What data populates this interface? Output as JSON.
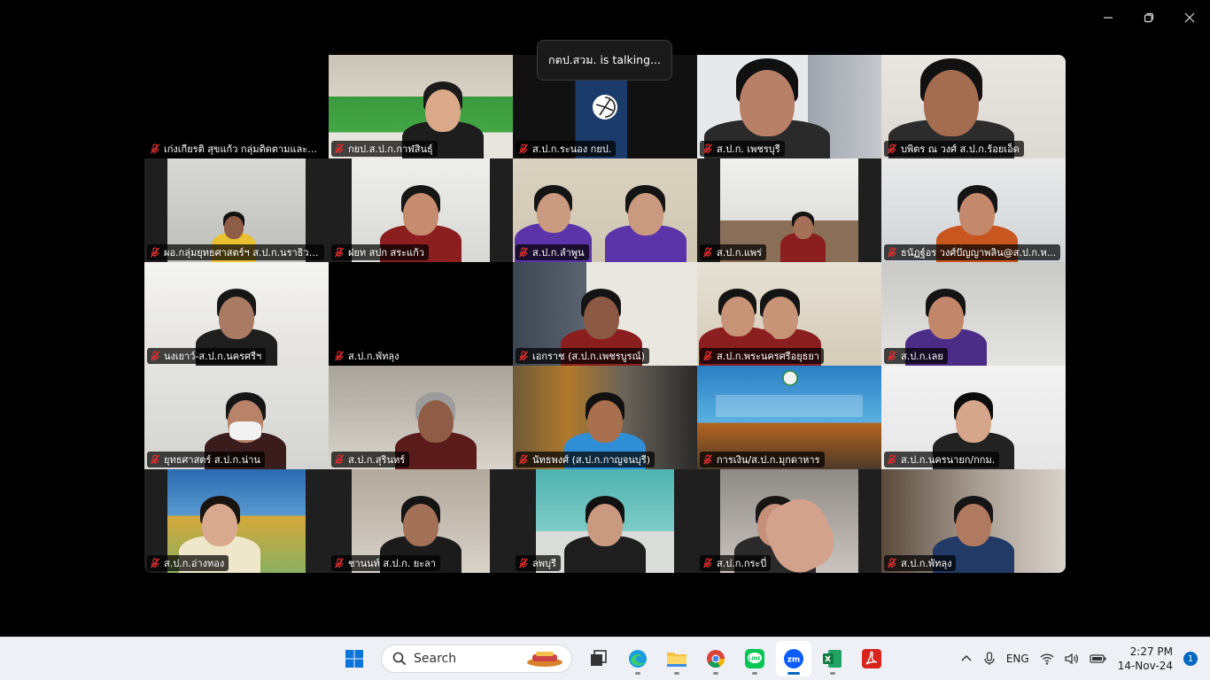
{
  "window": {
    "minimize_icon": "minimize-icon",
    "restore_icon": "restore-icon",
    "close_icon": "close-icon"
  },
  "talking_banner": "กตป.สวม. is talking...",
  "colors": {
    "muted_mic": "#e03030",
    "taskbar_bg": "#eef0f6",
    "accent": "#0067c0"
  },
  "participants": [
    {
      "name": "เก่งเกียรติ สุขแก้ว กลุ่มติดตามและประ...",
      "video": false
    },
    {
      "name": "กยป.ส.ป.ก.กาฬสินธุ์",
      "video": true
    },
    {
      "name": "ส.ป.ก.ระนอง กยป.",
      "video": true
    },
    {
      "name": "ส.ป.ก. เพชรบุรี",
      "video": true
    },
    {
      "name": "บพิตร  ณ วงศ์ ส.ป.ก.ร้อยเอ็ด",
      "video": true
    },
    {
      "name": "ผอ.กลุ่มยุทธศาสตร์ฯ ส.ป.ก.นราธิวาส",
      "video": true
    },
    {
      "name": "ฝยท สปก สระแก้ว",
      "video": true
    },
    {
      "name": "ส.ป.ก.ลำพูน",
      "video": true
    },
    {
      "name": "ส.ป.ก.แพร่",
      "video": true
    },
    {
      "name": "ธนัฏฐ์อร วงศ์ปัญญาพลิน@ส.ป.ก.ห...",
      "video": true
    },
    {
      "name": "นงเยาว์-ส.ป.ก.นครศรีฯ",
      "video": true
    },
    {
      "name": "ส.ป.ก.พัทลุง",
      "video": false
    },
    {
      "name": "เอกราช (ส.ป.ก.เพชรบูรณ์)",
      "video": true
    },
    {
      "name": "ส.ป.ก.พระนครศรีอยุธยา",
      "video": true
    },
    {
      "name": "ส.ป.ก.เลย",
      "video": true
    },
    {
      "name": "ยุทธศาสตร์ ส.ป.ก.น่าน",
      "video": true
    },
    {
      "name": "ส.ป.ก.สุรินทร์",
      "video": true
    },
    {
      "name": "นัทธพงศ์ (ส.ป.ก.กาญจนบุรี)",
      "video": true
    },
    {
      "name": "การเงิน/ส.ป.ก.มุกดาหาร",
      "video": true
    },
    {
      "name": "ส.ป.ก.นครนายก/กกม.",
      "video": true
    },
    {
      "name": "ส.ป.ก.อ่างทอง",
      "video": true
    },
    {
      "name": "ชานนท์ ส.ป.ก. ยะลา",
      "video": true
    },
    {
      "name": "ลพบุรี",
      "video": true
    },
    {
      "name": "ส.ป.ก.กระบี่",
      "video": true
    },
    {
      "name": "ส.ป.ก.พัทลุง",
      "video": true
    }
  ],
  "taskbar": {
    "search_placeholder": "Search",
    "apps": [
      {
        "icon": "task-view-icon"
      },
      {
        "icon": "edge-icon"
      },
      {
        "icon": "file-explorer-icon"
      },
      {
        "icon": "chrome-icon"
      },
      {
        "icon": "line-icon"
      },
      {
        "icon": "zoom-icon"
      },
      {
        "icon": "excel-icon"
      },
      {
        "icon": "acrobat-icon"
      }
    ],
    "language": "ENG",
    "time": "2:27 PM",
    "date": "14-Nov-24",
    "notifications": "1"
  }
}
